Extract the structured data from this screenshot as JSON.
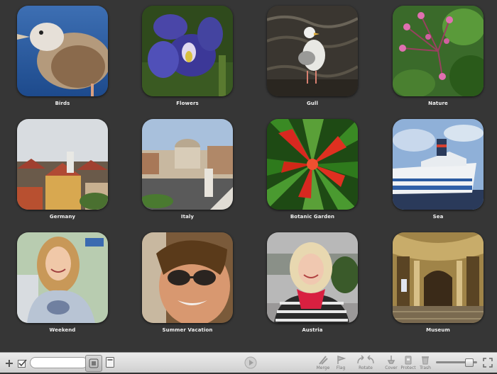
{
  "albums": [
    {
      "label": "Birds"
    },
    {
      "label": "Flowers"
    },
    {
      "label": "Gull"
    },
    {
      "label": "Nature"
    },
    {
      "label": "Germany"
    },
    {
      "label": "Italy"
    },
    {
      "label": "Botanic Garden"
    },
    {
      "label": "Sea"
    },
    {
      "label": "Weekend"
    },
    {
      "label": "Summer Vacation"
    },
    {
      "label": "Austria"
    },
    {
      "label": "Museum"
    }
  ],
  "toolbar": {
    "search_value": "",
    "tools": {
      "merge": "Merge",
      "flag": "Flag",
      "rotate": "Rotate",
      "cover": "Cover",
      "protect": "Protect",
      "trash": "Trash"
    },
    "zoom_level": 0.85
  },
  "icons": {
    "add": "plus-icon",
    "select": "checkbox-icon",
    "view_albums": "albums-view-icon",
    "view_single": "single-view-icon",
    "play": "play-icon",
    "merge": "merge-icon",
    "flag": "flag-icon",
    "rotate": "rotate-icon",
    "cover": "cover-icon",
    "protect": "protect-icon",
    "trash": "trash-icon",
    "fullscreen": "fullscreen-icon"
  }
}
